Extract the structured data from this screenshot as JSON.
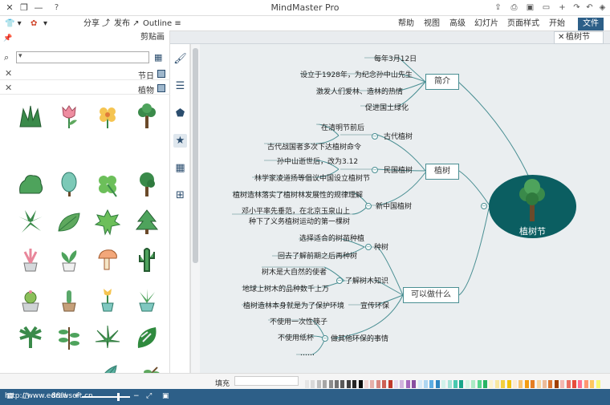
{
  "window": {
    "title": "MindMaster Pro"
  },
  "quick": {
    "file_label": "文件"
  },
  "ribbon": {
    "tabs": [
      "开始",
      "页面样式",
      "幻灯片",
      "高级",
      "视图",
      "帮助"
    ],
    "share_label": "分享",
    "publish_label": "发布",
    "outline_label": "Outline"
  },
  "doc": {
    "tab_title": "植树节"
  },
  "panel": {
    "title": "剪贴画",
    "libraries": [
      "节日",
      "植物"
    ]
  },
  "mindmap": {
    "central": "植树节",
    "branches": [
      {
        "label": "简介",
        "children": [
          "每年3月12日",
          "设立于1928年，为纪念孙中山先生",
          "激发人们爱林、造林的热情",
          "促进国土绿化"
        ]
      },
      {
        "label": "植树",
        "children": [
          {
            "label": "古代植树",
            "children": [
              "在清明节前后",
              "古代战国者多次下达植树命令"
            ]
          },
          {
            "label": "民国植树",
            "children": [
              "孙中山逝世后，改为3.12",
              "林学家凌道扬等倡议中国设立植树节"
            ]
          },
          {
            "label": "新中国植树",
            "children": [
              "邓小平率先垂范，在北京玉泉山上种下了义务植树运动的第一棵树",
              "植树造林落实了植树林发展性的规律理解"
            ]
          }
        ]
      },
      {
        "label": "可以做什么",
        "children": [
          {
            "label": "种树",
            "children": [
              "选择适合的树苗种植",
              "回去了解前期之后再种树"
            ]
          },
          {
            "label": "了解树木知识",
            "children": [
              "树木是大自然的使者",
              "地球上树木的品种数千上万"
            ]
          },
          {
            "label": "宣传环保",
            "children": [
              "植树造林本身就是为了保护环境"
            ]
          },
          {
            "label": "做其他环保的事情",
            "children": [
              "不使用一次性筷子",
              "不使用纸杯",
              "……"
            ]
          }
        ]
      }
    ]
  },
  "status": {
    "url": "http://www.edrawsoft.cn",
    "fill_label": "填充",
    "zoom": "88%"
  },
  "colors": {
    "brand": "#2d5f88",
    "central": "#0b5e61",
    "line": "#4a8f93"
  }
}
